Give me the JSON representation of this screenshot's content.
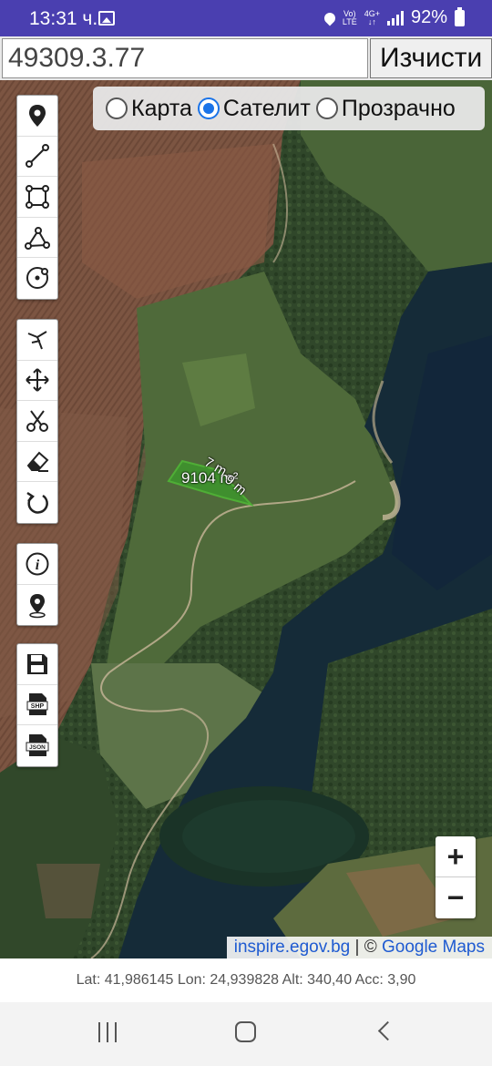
{
  "status_bar": {
    "time": "13:31 ч.",
    "volte_top": "Vo)",
    "volte_bottom": "LTE",
    "network_top": "4G+",
    "network_bottom": "↓↑",
    "battery": "92%"
  },
  "search": {
    "value": "49309.3.77",
    "clear_label": "Изчисти"
  },
  "layers": {
    "options": [
      "Карта",
      "Сателит",
      "Прозрачно"
    ],
    "selected": "Сателит"
  },
  "toolbar": {
    "groups": [
      [
        "marker-icon",
        "line-icon",
        "polygon-icon",
        "path-icon",
        "circle-icon"
      ],
      [
        "snap-icon",
        "move-icon",
        "cut-icon",
        "eraser-icon",
        "undo-icon"
      ],
      [
        "info-icon",
        "location-icon"
      ],
      [
        "save-icon",
        "shp-export-icon",
        "json-export-icon"
      ]
    ],
    "shp_label": "SHP",
    "json_label": "JSON"
  },
  "map": {
    "area_label": "9104 m²",
    "edge_label_1": "7 m",
    "edge_label_2": "9 m",
    "polygon_color": "#3f8f2e"
  },
  "zoom": {
    "in": "+",
    "out": "−"
  },
  "attribution": {
    "link1": "inspire.egov.bg",
    "separator": " | © ",
    "link2": "Google Maps"
  },
  "coords": "Lat: 41,986145 Lon: 24,939828 Alt: 340,40 Acc: 3,90",
  "colors": {
    "status_bar": "#4a3fb0",
    "water": "#142a38",
    "forest": "#2e4424",
    "field": "#7a5440"
  }
}
